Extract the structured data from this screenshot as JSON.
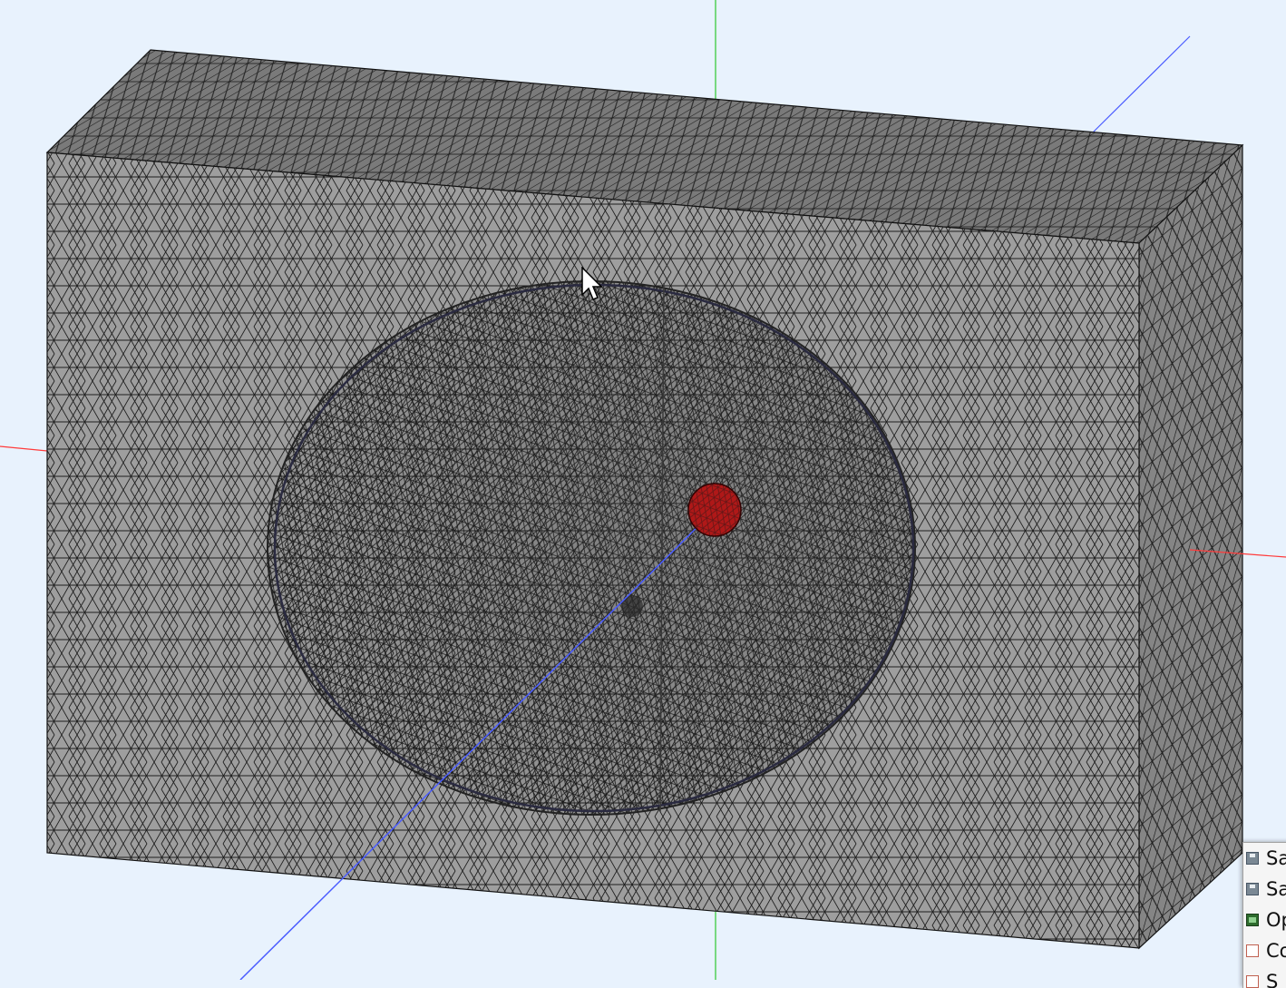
{
  "viewport": {
    "background": "#e8f2fd",
    "axes": {
      "x_color": "#ff3b3b",
      "y_color": "#2ec82e",
      "z_color": "#4a5cff"
    },
    "mesh": {
      "face_color": "#9e9e9e",
      "top_color": "#7a7a7a",
      "side_color": "#858585",
      "edge_color": "#1a1a1a",
      "highlight_color": "#b01818"
    }
  },
  "context_menu": {
    "items": [
      {
        "label": "Sa",
        "icon": "save-icon"
      },
      {
        "label": "Sa",
        "icon": "save-as-icon"
      },
      {
        "label": "Op",
        "icon": "open-icon"
      },
      {
        "label": "Co",
        "icon": "page-icon"
      },
      {
        "label": "S",
        "icon": "page-icon"
      }
    ]
  }
}
